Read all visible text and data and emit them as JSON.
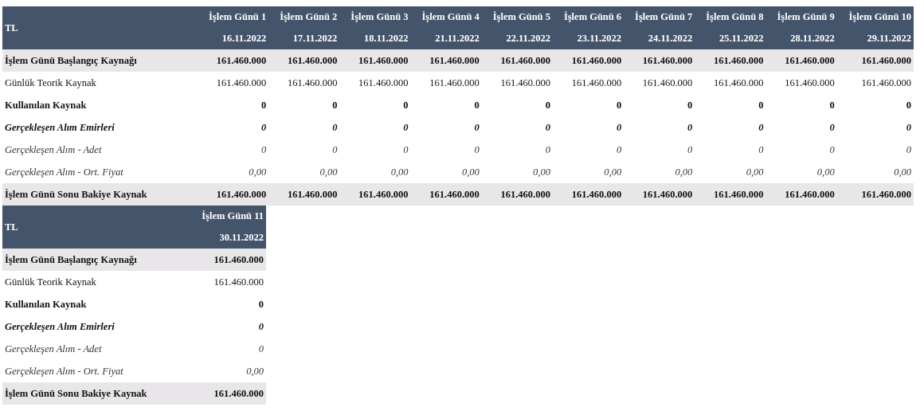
{
  "tables": [
    {
      "corner": "TL",
      "columns": [
        {
          "day": "İşlem Günü 1",
          "date": "16.11.2022"
        },
        {
          "day": "İşlem Günü 2",
          "date": "17.11.2022"
        },
        {
          "day": "İşlem Günü 3",
          "date": "18.11.2022"
        },
        {
          "day": "İşlem Günü 4",
          "date": "21.11.2022"
        },
        {
          "day": "İşlem Günü 5",
          "date": "22.11.2022"
        },
        {
          "day": "İşlem Günü 6",
          "date": "23.11.2022"
        },
        {
          "day": "İşlem Günü 7",
          "date": "24.11.2022"
        },
        {
          "day": "İşlem Günü 8",
          "date": "25.11.2022"
        },
        {
          "day": "İşlem Günü 9",
          "date": "28.11.2022"
        },
        {
          "day": "İşlem Günü 10",
          "date": "29.11.2022"
        }
      ],
      "rows": [
        {
          "label": "İşlem Günü Başlangıç Kaynağı",
          "kind": "shaded",
          "values": [
            "161.460.000",
            "161.460.000",
            "161.460.000",
            "161.460.000",
            "161.460.000",
            "161.460.000",
            "161.460.000",
            "161.460.000",
            "161.460.000",
            "161.460.000"
          ]
        },
        {
          "label": "Günlük Teorik Kaynak",
          "kind": "plain",
          "values": [
            "161.460.000",
            "161.460.000",
            "161.460.000",
            "161.460.000",
            "161.460.000",
            "161.460.000",
            "161.460.000",
            "161.460.000",
            "161.460.000",
            "161.460.000"
          ]
        },
        {
          "label": "Kullanılan Kaynak",
          "kind": "bold",
          "values": [
            "0",
            "0",
            "0",
            "0",
            "0",
            "0",
            "0",
            "0",
            "0",
            "0"
          ]
        },
        {
          "label": "Gerçekleşen Alım Emirleri",
          "kind": "bolditalic",
          "values": [
            "0",
            "0",
            "0",
            "0",
            "0",
            "0",
            "0",
            "0",
            "0",
            "0"
          ]
        },
        {
          "label": "Gerçekleşen Alım - Adet",
          "kind": "italic",
          "values": [
            "0",
            "0",
            "0",
            "0",
            "0",
            "0",
            "0",
            "0",
            "0",
            "0"
          ]
        },
        {
          "label": "Gerçekleşen Alım - Ort. Fiyat",
          "kind": "italic",
          "values": [
            "0,00",
            "0,00",
            "0,00",
            "0,00",
            "0,00",
            "0,00",
            "0,00",
            "0,00",
            "0,00",
            "0,00"
          ]
        },
        {
          "label": "İşlem Günü Sonu Bakiye Kaynak",
          "kind": "shaded",
          "values": [
            "161.460.000",
            "161.460.000",
            "161.460.000",
            "161.460.000",
            "161.460.000",
            "161.460.000",
            "161.460.000",
            "161.460.000",
            "161.460.000",
            "161.460.000"
          ]
        }
      ]
    },
    {
      "corner": "TL",
      "columns": [
        {
          "day": "İşlem Günü 11",
          "date": "30.11.2022"
        }
      ],
      "rows": [
        {
          "label": "İşlem Günü Başlangıç Kaynağı",
          "kind": "shaded",
          "values": [
            "161.460.000"
          ]
        },
        {
          "label": "Günlük Teorik Kaynak",
          "kind": "plain",
          "values": [
            "161.460.000"
          ]
        },
        {
          "label": "Kullanılan Kaynak",
          "kind": "bold",
          "values": [
            "0"
          ]
        },
        {
          "label": "Gerçekleşen Alım Emirleri",
          "kind": "bolditalic",
          "values": [
            "0"
          ]
        },
        {
          "label": "Gerçekleşen Alım - Adet",
          "kind": "italic",
          "values": [
            "0"
          ]
        },
        {
          "label": "Gerçekleşen Alım - Ort. Fiyat",
          "kind": "italic",
          "values": [
            "0,00"
          ]
        },
        {
          "label": "İşlem Günü Sonu Bakiye Kaynak",
          "kind": "shaded",
          "values": [
            "161.460.000"
          ]
        }
      ]
    }
  ]
}
